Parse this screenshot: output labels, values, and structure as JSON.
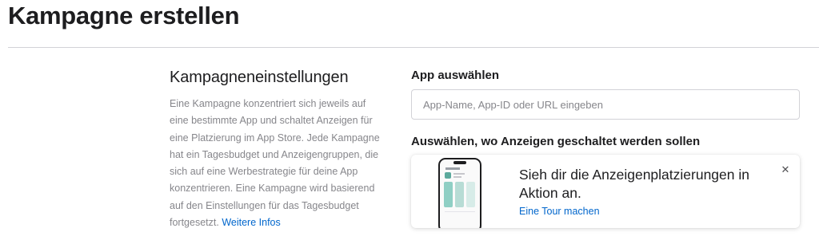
{
  "header": {
    "title": "Kampagne erstellen"
  },
  "settings": {
    "title": "Kampagneneinstellungen",
    "description": "Eine Kampagne konzentriert sich jeweils auf eine bestimmte App und schaltet Anzeigen für eine Platzierung im App Store. Jede Kampagne hat ein Tagesbudget und Anzeigengruppen, die sich auf eine Werbestrategie für deine App konzentrieren. Eine Kampagne wird basierend auf den Einstellungen für das Tagesbudget fortgesetzt.",
    "more_link": "Weitere Infos"
  },
  "app_select": {
    "label": "App auswählen",
    "value": "",
    "placeholder": "App-Name, App-ID oder URL eingeben"
  },
  "placement": {
    "label": "Auswählen, wo Anzeigen geschaltet werden sollen",
    "promo": {
      "heading": "Sieh dir die Anzeigenplatzierungen in Aktion an.",
      "link": "Eine Tour machen",
      "close_icon": "close-icon",
      "illustration_icon": "iphone-illustration-icon"
    }
  },
  "colors": {
    "link": "#0066cc",
    "text_primary": "#1d1d1f",
    "text_secondary": "#86868b",
    "border": "#d2d2d7"
  }
}
